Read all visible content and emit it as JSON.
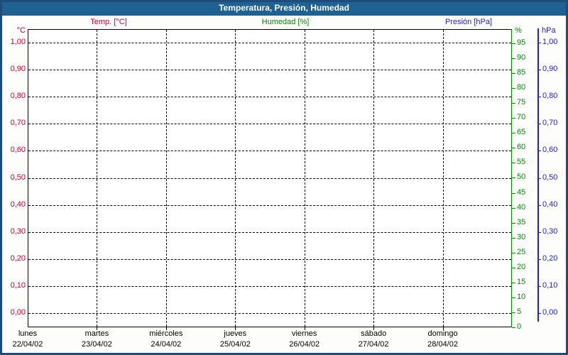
{
  "window": {
    "title": "Temperatura, Presión, Humedad"
  },
  "legend": [
    {
      "id": "temp",
      "label": "Temp. [°C]",
      "color": "#cc0033"
    },
    {
      "id": "humidity",
      "label": "Humedad [%]",
      "color": "#008a00"
    },
    {
      "id": "pressure",
      "label": "Presión [hPa]",
      "color": "#2222cc"
    }
  ],
  "colors": {
    "titlebar_bg": "#1f6191",
    "frame_border": "#1e4d7c",
    "temp": "#cc0033",
    "humidity": "#008a00",
    "pressure": "#2222cc",
    "grid": "#000000",
    "plot_bg": "#ffffff"
  },
  "axes": {
    "temp": {
      "header": "°C",
      "ticks": [
        "1,00",
        "0,90",
        "0,80",
        "0,70",
        "0,60",
        "0,50",
        "0,40",
        "0,30",
        "0,20",
        "0,10",
        "0,00"
      ]
    },
    "humidity": {
      "header": "%",
      "ticks": [
        "95",
        "90",
        "85",
        "80",
        "75",
        "70",
        "65",
        "60",
        "55",
        "50",
        "45",
        "40",
        "35",
        "30",
        "25",
        "20",
        "15",
        "10",
        "5",
        "0"
      ]
    },
    "pressure": {
      "header": "hPa",
      "ticks": [
        "1,00",
        "0,90",
        "0,80",
        "0,70",
        "0,60",
        "0,50",
        "0,40",
        "0,30",
        "0,20",
        "0,10",
        "0,00"
      ]
    },
    "x": {
      "days": [
        "lunes",
        "martes",
        "miércoles",
        "jueves",
        "viernes",
        "sábado",
        "domingo"
      ],
      "dates": [
        "22/04/02",
        "23/04/02",
        "24/04/02",
        "25/04/02",
        "26/04/02",
        "27/04/02",
        "28/04/02"
      ]
    }
  },
  "chart_data": {
    "type": "line",
    "title": "Temperatura, Presión, Humedad",
    "x_day_names": [
      "lunes",
      "martes",
      "miércoles",
      "jueves",
      "viernes",
      "sábado",
      "domingo"
    ],
    "x_categories": [
      "22/04/02",
      "23/04/02",
      "24/04/02",
      "25/04/02",
      "26/04/02",
      "27/04/02",
      "28/04/02"
    ],
    "series": [
      {
        "name": "Temp. [°C]",
        "axis": "left_temp",
        "color": "#cc0033",
        "values": []
      },
      {
        "name": "Humedad [%]",
        "axis": "right_humidity",
        "color": "#008a00",
        "values": []
      },
      {
        "name": "Presión [hPa]",
        "axis": "right_pressure",
        "color": "#2222cc",
        "values": []
      }
    ],
    "axes": {
      "left_temp": {
        "label": "°C",
        "min": 0.0,
        "max": 1.0,
        "step": 0.1,
        "decimal_separator": ","
      },
      "right_humidity": {
        "label": "%",
        "min": 0,
        "max": 100,
        "step": 5
      },
      "right_pressure": {
        "label": "hPa",
        "min": 0.0,
        "max": 1.0,
        "step": 0.1,
        "decimal_separator": ","
      }
    },
    "grid": true,
    "legend_position": "top"
  }
}
